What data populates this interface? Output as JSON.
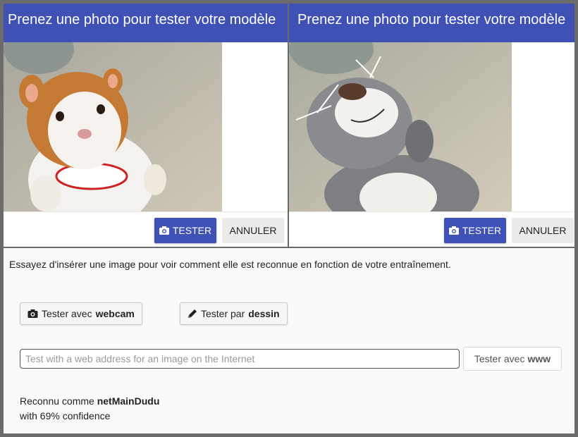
{
  "panels": [
    {
      "header": "Prenez une photo pour tester votre modèle",
      "test_label": "TESTER",
      "cancel_label": "ANNULER",
      "photo_subject": "hamster plush toy"
    },
    {
      "header": "Prenez une photo pour tester votre modèle",
      "test_label": "TESTER",
      "cancel_label": "ANNULER",
      "photo_subject": "grey plush toy"
    }
  ],
  "tester": {
    "intro": "Essayez d'insérer une image pour voir comment elle est reconnue en fonction de votre entraînement.",
    "webcam_prefix": "Tester avec",
    "webcam_bold": "webcam",
    "drawing_prefix": "Tester par",
    "drawing_bold": "dessin",
    "url_placeholder": "Test with a web address for an image on the Internet",
    "url_value": "",
    "www_prefix": "Tester avec",
    "www_bold": "www"
  },
  "result": {
    "prefix": "Reconnu comme",
    "label": "netMainDudu",
    "confidence_text": "with 69% confidence",
    "confidence": 69
  },
  "colors": {
    "primary": "#3f51b5",
    "cancel_bg": "#ebebeb",
    "frame": "#6b6b6b"
  },
  "icons": {
    "test": "camera-icon",
    "webcam": "camera-icon",
    "drawing": "pencil-icon"
  }
}
